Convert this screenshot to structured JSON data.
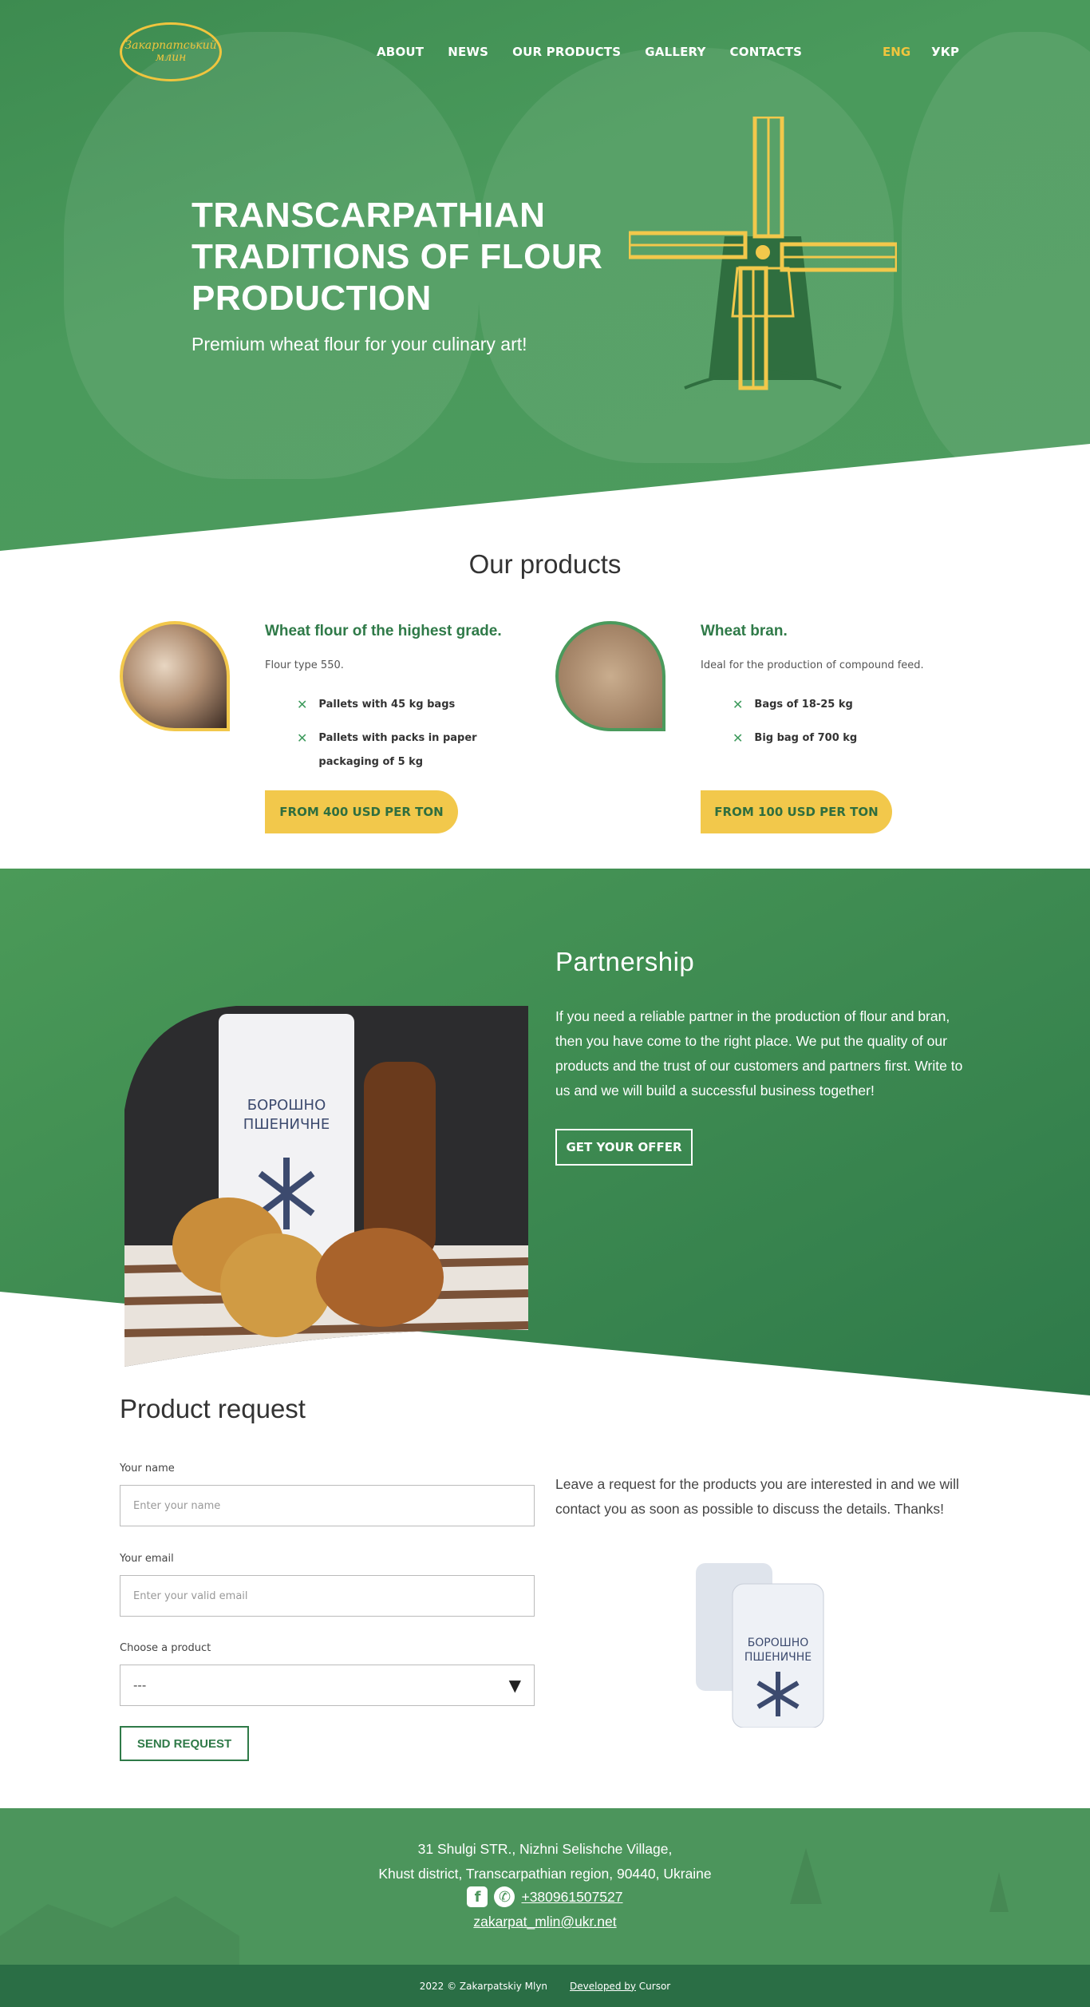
{
  "header": {
    "logo_text": "Закарпатський млин",
    "nav": [
      "ABOUT",
      "NEWS",
      "OUR PRODUCTS",
      "GALLERY",
      "CONTACTS"
    ],
    "lang_active": "ENG",
    "lang_other": "УКР"
  },
  "hero": {
    "title": "TRANSCARPATHIAN TRADITIONS OF FLOUR PRODUCTION",
    "subtitle": "Premium wheat flour for your culinary art!"
  },
  "products": {
    "heading": "Our products",
    "items": [
      {
        "title": "Wheat flour of the highest grade.",
        "desc": "Flour type 550.",
        "features": [
          "Pallets with 45 kg bags",
          "Pallets with packs in paper packaging of 5 kg"
        ],
        "price": "FROM 400 USD PER TON"
      },
      {
        "title": "Wheat bran.",
        "desc": "Ideal for the production of compound feed.",
        "features": [
          "Bags of 18-25 kg",
          "Big bag of 700 kg"
        ],
        "price": "FROM 100 USD PER TON"
      }
    ]
  },
  "partnership": {
    "heading": "Partnership",
    "text": "If you need a reliable partner in the production of flour and bran, then you have come to the right place. We put the quality of our products and the trust of our customers and partners first. Write to us and we will build a successful business together!",
    "button": "GET YOUR OFFER",
    "package_text_1": "БОРОШНО",
    "package_text_2": "ПШЕНИЧНЕ"
  },
  "request": {
    "heading": "Product request",
    "name_label": "Your name",
    "name_placeholder": "Enter your name",
    "email_label": "Your email",
    "email_placeholder": "Enter your valid email",
    "product_label": "Choose a product",
    "product_value": "---",
    "submit": "SEND REQUEST",
    "text": "Leave a request for the products you are interested in and we will contact you as soon as possible to discuss the details. Thanks!"
  },
  "footer": {
    "address_line1": "31 Shulgi STR., Nizhni Selishche Village,",
    "address_line2": "Khust district, Transcarpathian region, 90440, Ukraine",
    "phone": "+380961507527",
    "email": "zakarpat_mlin@ukr.net",
    "copyright": "2022 © Zakarpatskiy Mlyn",
    "developed_prefix": "Developed by",
    "developer": "Cursor"
  },
  "colors": {
    "green": "#3d8b50",
    "dark_green": "#2a6e45",
    "yellow": "#f2c84b",
    "white": "#ffffff"
  }
}
